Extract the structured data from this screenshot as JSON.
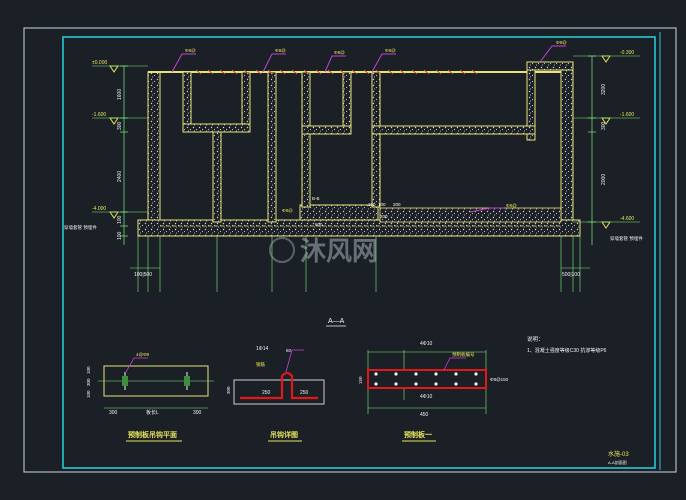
{
  "drawing": {
    "colors": {
      "background": "#1b2027",
      "frame": "#27c8d6",
      "wall": "#e8e27a",
      "dim": "#7ef07a",
      "leader": "#c63fd6",
      "rebar": "#e01818",
      "text_white": "#f2f2f2",
      "text_yellow": "#e6e25a"
    },
    "elevations_left": [
      "±0.000",
      "-1.600",
      "-4.000"
    ],
    "elevations_right": [
      "-0.300",
      "-1.600",
      "-4.600"
    ],
    "dims_left": [
      "1600",
      "300",
      "2400",
      "100",
      "100"
    ],
    "dims_right": [
      "3200",
      "300",
      "2000"
    ],
    "bottom_dims_left": "100|500",
    "bottom_dims_right": "500|100",
    "center_dims": [
      "100",
      "100",
      "200",
      "600",
      "200"
    ],
    "leader_tags": [
      "Φ8@",
      "Φ8@",
      "Φ8@",
      "Φ8@",
      "Φ8@",
      "Φ8@"
    ],
    "side_note_left": "穿墙套管 预埋件",
    "side_note_right": "穿墙套管 预埋件",
    "center_labels": [
      "Φ8@",
      "B-B"
    ],
    "section_label": "A—A",
    "notes": {
      "title": "说明：",
      "line1": "1、混凝土强度等级C30 抗渗等级P6"
    },
    "detail1": {
      "title": "预制板吊钩平面",
      "dims": [
        "300",
        "板长L",
        "300"
      ],
      "top_label": "4@Φ8",
      "side_dims": [
        "100",
        "300",
        "100"
      ]
    },
    "detail2": {
      "title": "吊钩详图",
      "top": "1Φ14",
      "mid": "60",
      "tag": "钢筋",
      "side": "300",
      "dims": [
        "250",
        "250"
      ]
    },
    "detail3": {
      "title": "预制板一",
      "top": "4Φ10",
      "bottom": "4Φ10",
      "right": "Φ8@150",
      "width": "450",
      "height": "150",
      "tag": "预制板编号"
    },
    "titleblock": {
      "code": "水施-03",
      "sub": "A-A剖面图"
    },
    "watermark": "沐风网"
  }
}
